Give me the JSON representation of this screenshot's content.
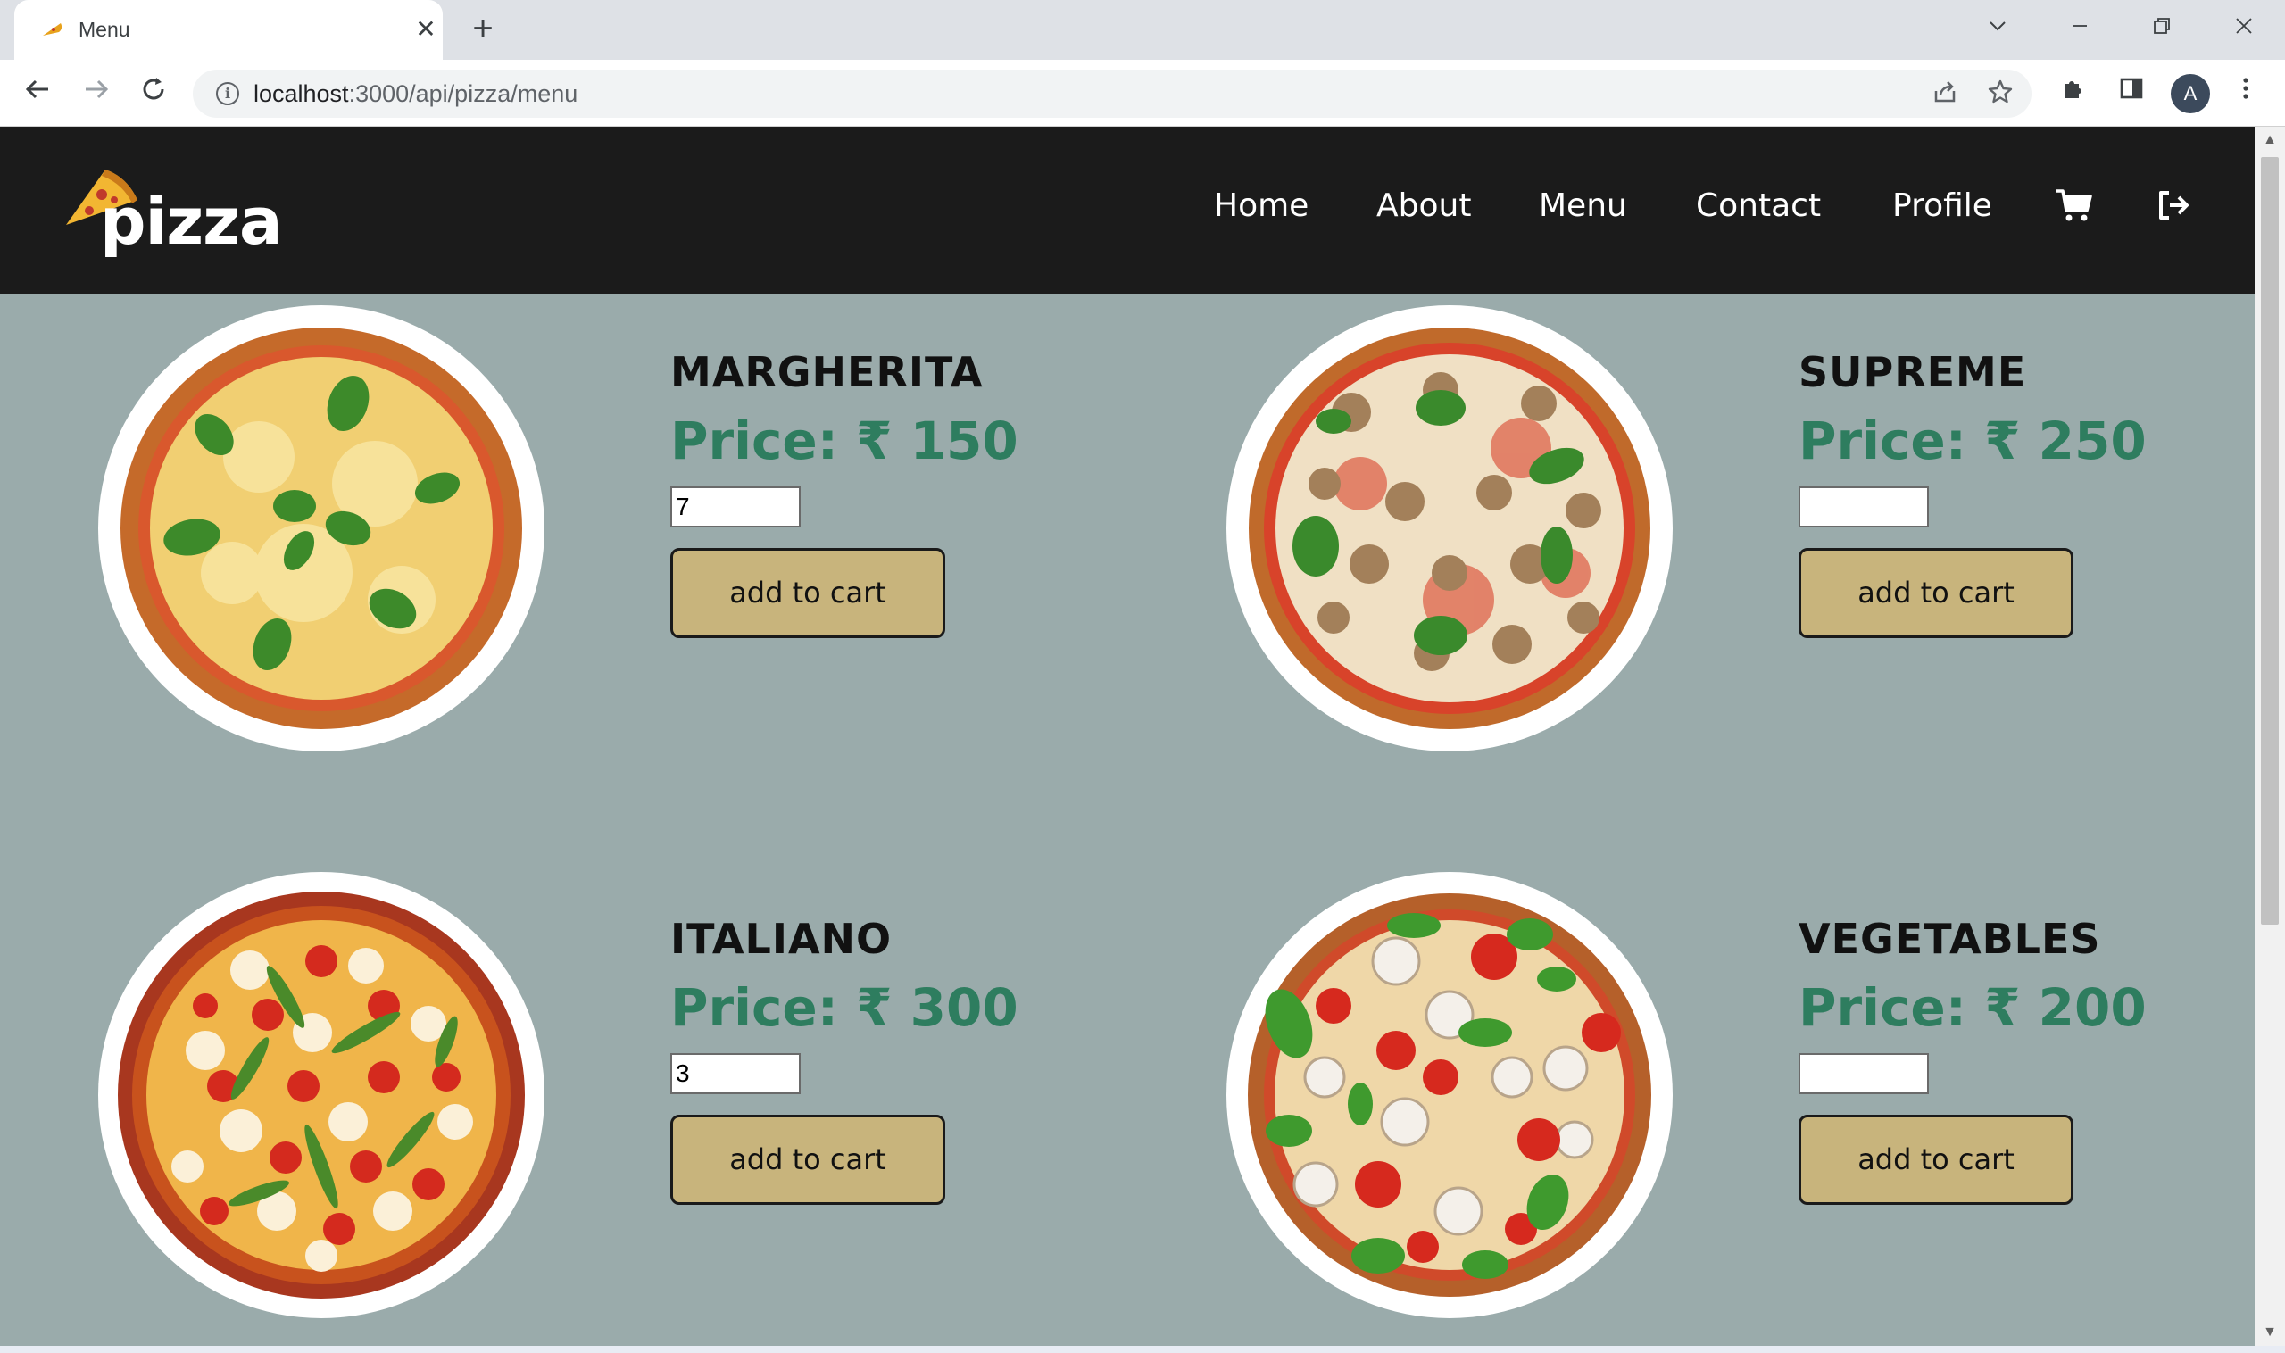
{
  "browser": {
    "tab_title": "Menu",
    "tab_close": "✕",
    "new_tab": "+",
    "url_host": "localhost",
    "url_rest": ":3000/api/pizza/menu",
    "avatar_letter": "A"
  },
  "site": {
    "logo_text": "pizza",
    "nav": {
      "home": "Home",
      "about": "About",
      "menu": "Menu",
      "contact": "Contact",
      "profile": "Profile"
    },
    "colors": {
      "header_bg": "#1b1b1b",
      "page_bg": "#9aabab",
      "price": "#2e7d5f",
      "button": "#c8b47c"
    }
  },
  "menu": {
    "items": [
      {
        "name": "MARGHERITA",
        "price": "Price: ₹ 150",
        "quantity": "7",
        "button": "add to cart",
        "style": "margherita"
      },
      {
        "name": "SUPREME",
        "price": "Price: ₹ 250",
        "quantity": "",
        "button": "add to cart",
        "style": "supreme"
      },
      {
        "name": "ITALIANO",
        "price": "Price: ₹ 300",
        "quantity": "3",
        "button": "add to cart",
        "style": "italiano"
      },
      {
        "name": "VEGETABLES",
        "price": "Price: ₹ 200",
        "quantity": "",
        "button": "add to cart",
        "style": "vegetables"
      }
    ]
  }
}
